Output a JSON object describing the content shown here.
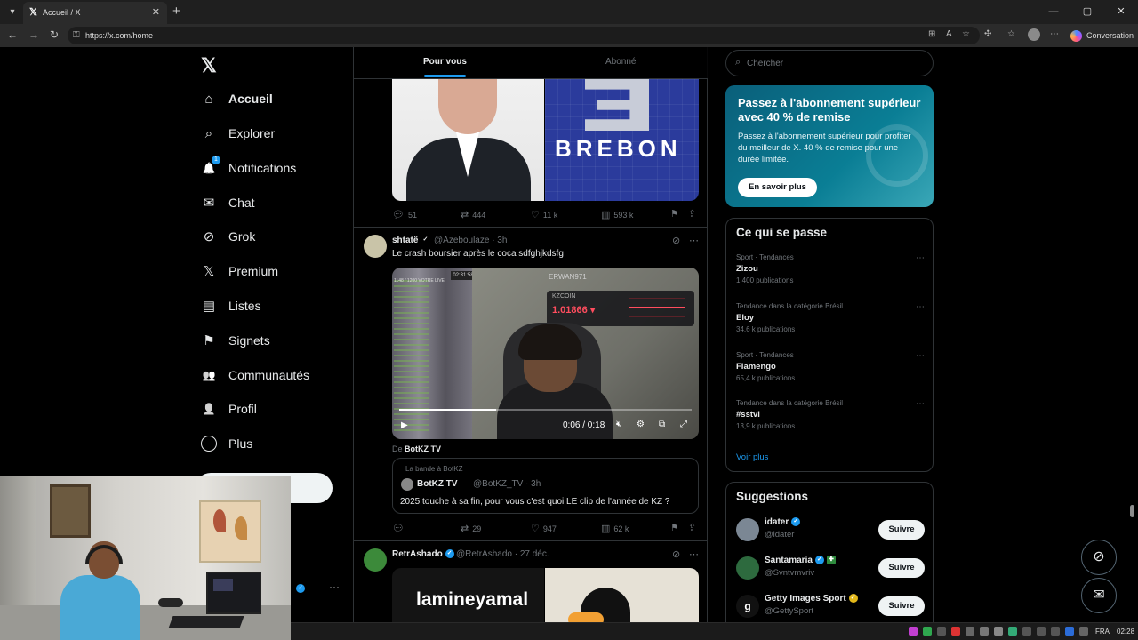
{
  "browser": {
    "tab_title": "Accueil / X",
    "url": "https://x.com/home",
    "conversation_label": "Conversation",
    "window_controls": [
      "—",
      "▢",
      "✕"
    ]
  },
  "nav": {
    "logo": "𝕏",
    "items": [
      {
        "label": "Accueil",
        "icon": "home-icon",
        "glyph": "⌂"
      },
      {
        "label": "Explorer",
        "icon": "search-icon",
        "glyph": "⌕"
      },
      {
        "label": "Notifications",
        "icon": "bell-icon",
        "glyph": "🔔",
        "badge": "1"
      },
      {
        "label": "Chat",
        "icon": "mail-icon",
        "glyph": "✉"
      },
      {
        "label": "Grok",
        "icon": "grok-icon",
        "glyph": "⊘"
      },
      {
        "label": "Premium",
        "icon": "x-icon",
        "glyph": "𝕏"
      },
      {
        "label": "Listes",
        "icon": "list-icon",
        "glyph": "▤"
      },
      {
        "label": "Signets",
        "icon": "bookmark-icon",
        "glyph": "⚑"
      },
      {
        "label": "Communautés",
        "icon": "people-icon",
        "glyph": "👥"
      },
      {
        "label": "Profil",
        "icon": "person-icon",
        "glyph": "👤"
      },
      {
        "label": "Plus",
        "icon": "more-circle-icon",
        "glyph": "⋯"
      }
    ]
  },
  "feed": {
    "tabs": [
      "Pour vous",
      "Abonné"
    ],
    "post1": {
      "brand_text": "BREBON",
      "replies": "51",
      "reposts": "444",
      "likes": "11 k",
      "views": "593 k"
    },
    "post2": {
      "name": "shtatë",
      "handle": "@Azeboulaze · 3h",
      "text": "Le crash boursier après le coca sdfghjkdsfg",
      "video": {
        "time": "0:06 / 0:18",
        "progress": 0.33,
        "watermark": "ERWAN971",
        "ticker_label": "KZCOIN",
        "ticker_value": "1.01866 ▾",
        "stream_timer": "02:31:58",
        "viewers": "1148 / 1200 VOTRE LIVE"
      },
      "from_prefix": "De",
      "from_name": "BotKZ TV",
      "quote": {
        "community": "La bande à BotKZ",
        "name": "BotKZ TV",
        "handle": "@BotKZ_TV · 3h",
        "text": "2025 touche à sa fin, pour vous c'est quoi LE clip de l'année de KZ ?"
      },
      "replies": "",
      "reposts": "29",
      "likes": "947",
      "views": "62 k"
    },
    "post3": {
      "name": "RetrAshado",
      "handle": "@RetrAshado · 27 déc.",
      "image_text": "lamineyamal"
    }
  },
  "right": {
    "search_placeholder": "Chercher",
    "promo": {
      "title": "Passez à l'abonnement supérieur avec 40 % de remise",
      "body": "Passez à l'abonnement supérieur pour profiter du meilleur de X. 40 % de remise pour une durée limitée.",
      "cta": "En savoir plus"
    },
    "trends": {
      "title": "Ce qui se passe",
      "items": [
        {
          "context": "Sport · Tendances",
          "name": "Zizou",
          "posts": "1 400 publications"
        },
        {
          "context": "Tendance dans la catégorie Brésil",
          "name": "Eloy",
          "posts": "34,6 k publications"
        },
        {
          "context": "Sport · Tendances",
          "name": "Flamengo",
          "posts": "65,4 k publications"
        },
        {
          "context": "Tendance dans la catégorie Brésil",
          "name": "#sstvi",
          "posts": "13,9 k publications"
        }
      ],
      "more": "Voir plus"
    },
    "suggestions": {
      "title": "Suggestions",
      "follow_label": "Suivre",
      "items": [
        {
          "name": "idater",
          "handle": "@idater",
          "color": "#7b8794"
        },
        {
          "name": "Santamaria",
          "handle": "@Svntvmvriv",
          "color": "#2d6a3e"
        },
        {
          "name": "Getty Images Sport",
          "handle": "@GettySport",
          "color": "#111111"
        }
      ]
    }
  },
  "taskbar": {
    "lang": "FRA",
    "time": "02:28"
  },
  "colors": {
    "accent": "#1d9bf0",
    "bg": "#000000",
    "border": "#2f3336",
    "muted": "#71767b"
  }
}
